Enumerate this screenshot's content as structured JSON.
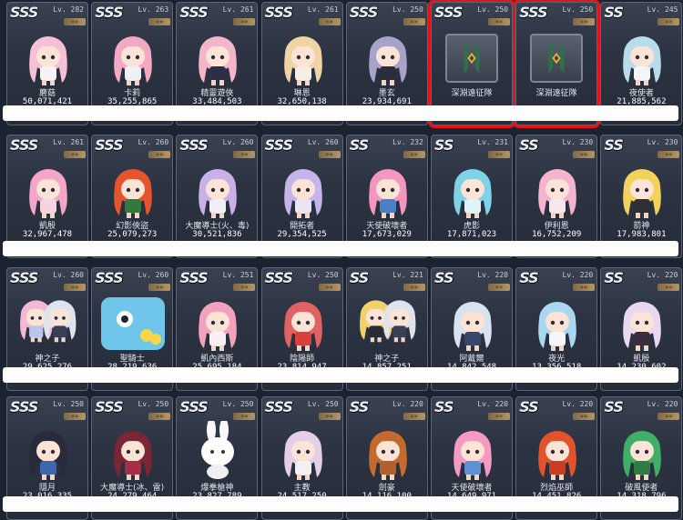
{
  "rows": [
    [
      {
        "tier": "SSS",
        "level": "Lv. 282",
        "name": "蘑菇",
        "power": "50,071,421",
        "hair": "#f4c1d6",
        "outfit": "#f7f2f5"
      },
      {
        "tier": "SSS",
        "level": "Lv. 263",
        "name": "卡莉",
        "power": "35,255,865",
        "hair": "#f3a9c4",
        "outfit": "#eef0f8"
      },
      {
        "tier": "SSS",
        "level": "Lv. 261",
        "name": "精靈遊俠",
        "power": "33,484,503",
        "hair": "#f2b6c8",
        "outfit": "#2b2f4a"
      },
      {
        "tier": "SSS",
        "level": "Lv. 261",
        "name": "琳恩",
        "power": "32,650,138",
        "hair": "#f1d4a5",
        "outfit": "#f4eee4"
      },
      {
        "tier": "SSS",
        "level": "Lv. 250",
        "name": "墨玄",
        "power": "23,934,691",
        "hair": "#a7a3c9",
        "outfit": "#2a2d3d"
      },
      {
        "tier": "SSS",
        "level": "Lv. 250",
        "name": "深淵遠征隊",
        "power": "",
        "emblem": true,
        "selected": true
      },
      {
        "tier": "SSS",
        "level": "Lv. 250",
        "name": "深淵遠征隊",
        "power": "",
        "emblem": true,
        "selected": true
      },
      {
        "tier": "SS",
        "level": "Lv. 245",
        "name": "夜使者",
        "power": "21,885,562",
        "hair": "#b9dcea",
        "outfit": "#f3f6f9"
      }
    ],
    [
      {
        "tier": "SSS",
        "level": "Lv. 261",
        "name": "凱殷",
        "power": "32,967,478",
        "hair": "#f5a6c7",
        "outfit": "#f6d3e0"
      },
      {
        "tier": "SSS",
        "level": "Lv. 260",
        "name": "幻影俠盜",
        "power": "25,079,273",
        "hair": "#e4552e",
        "outfit": "#2f7a3c"
      },
      {
        "tier": "SSS",
        "level": "Lv. 260",
        "name": "大魔導士(火、毒)",
        "power": "30,521,836",
        "hair": "#c7b1e6",
        "outfit": "#f2eef8"
      },
      {
        "tier": "SSS",
        "level": "Lv. 260",
        "name": "開拓者",
        "power": "29,354,525",
        "hair": "#c5b4ea",
        "outfit": "#eae4f5"
      },
      {
        "tier": "SS",
        "level": "Lv. 232",
        "name": "天使破壞者",
        "power": "17,673,029",
        "hair": "#f497bf",
        "outfit": "#4d7fc9"
      },
      {
        "tier": "SS",
        "level": "Lv. 231",
        "name": "虎影",
        "power": "17,871,023",
        "hair": "#7fd3e8",
        "outfit": "#dff3fa"
      },
      {
        "tier": "SS",
        "level": "Lv. 230",
        "name": "伊利恩",
        "power": "16,752,209",
        "hair": "#f6b3cd",
        "outfit": "#f7e6ee"
      },
      {
        "tier": "SS",
        "level": "Lv. 230",
        "name": "箭神",
        "power": "17,983,801",
        "hair": "#f3d25c",
        "outfit": "#2f2f38"
      }
    ],
    [
      {
        "tier": "SSS",
        "level": "Lv. 260",
        "name": "神之子",
        "power": "29,625,276",
        "hair": "#f4b7d4",
        "outfit": "#b9c6ea",
        "twin": true
      },
      {
        "tier": "SSS",
        "level": "Lv. 260",
        "name": "聖騎士",
        "power": "28,219,636",
        "hair": "#66c3e8",
        "outfit": "#f0f6fa",
        "mascot": true
      },
      {
        "tier": "SSS",
        "level": "Lv. 251",
        "name": "凱內西斯",
        "power": "25,695,184",
        "hair": "#f2a2bd",
        "outfit": "#f7f1f4"
      },
      {
        "tier": "SSS",
        "level": "Lv. 250",
        "name": "陰陽師",
        "power": "23,814,947",
        "hair": "#e06262",
        "outfit": "#d8403a"
      },
      {
        "tier": "SS",
        "level": "Lv. 221",
        "name": "神之子",
        "power": "14,857,251",
        "hair": "#f3d16a",
        "outfit": "#2c2b35",
        "twin": true
      },
      {
        "tier": "SS",
        "level": "Lv. 220",
        "name": "阿戴爾",
        "power": "14,842,548",
        "hair": "#d8e3ef",
        "outfit": "#37466b"
      },
      {
        "tier": "SS",
        "level": "Lv. 220",
        "name": "夜光",
        "power": "13,356,518",
        "hair": "#a9d7ef",
        "outfit": "#f4f6f9"
      },
      {
        "tier": "SS",
        "level": "Lv. 220",
        "name": "凱殷",
        "power": "14,230,602",
        "hair": "#e9d9f0",
        "outfit": "#3a2e3e"
      }
    ],
    [
      {
        "tier": "SSS",
        "level": "Lv. 250",
        "name": "隱月",
        "power": "23,016,335",
        "hair": "#2a2b3a",
        "outfit": "#3f67b0"
      },
      {
        "tier": "SSS",
        "level": "Lv. 250",
        "name": "大魔導士(冰、雷)",
        "power": "24,279,464",
        "hair": "#7b2636",
        "outfit": "#a52e48"
      },
      {
        "tier": "SSS",
        "level": "Lv. 250",
        "name": "爆拳槍神",
        "power": "23,827,789",
        "hair": "#f7f7f7",
        "outfit": "#ffffff",
        "bunny": true
      },
      {
        "tier": "SSS",
        "level": "Lv. 250",
        "name": "主教",
        "power": "24,517,250",
        "hair": "#e5cfe8",
        "outfit": "#f3eff2"
      },
      {
        "tier": "SS",
        "level": "Lv. 220",
        "name": "劍豪",
        "power": "14,116,100",
        "hair": "#c46a2e",
        "outfit": "#b0602a"
      },
      {
        "tier": "SS",
        "level": "Lv. 220",
        "name": "天使破壞者",
        "power": "14,649,971",
        "hair": "#f59ac3",
        "outfit": "#5f90d6"
      },
      {
        "tier": "SS",
        "level": "Lv. 220",
        "name": "烈焰巫師",
        "power": "14,451,826",
        "hair": "#e2522b",
        "outfit": "#c93c26"
      },
      {
        "tier": "SS",
        "level": "Lv. 220",
        "name": "破風使者",
        "power": "14,318,796",
        "hair": "#3fae67",
        "outfit": "#2f7d46"
      }
    ]
  ]
}
